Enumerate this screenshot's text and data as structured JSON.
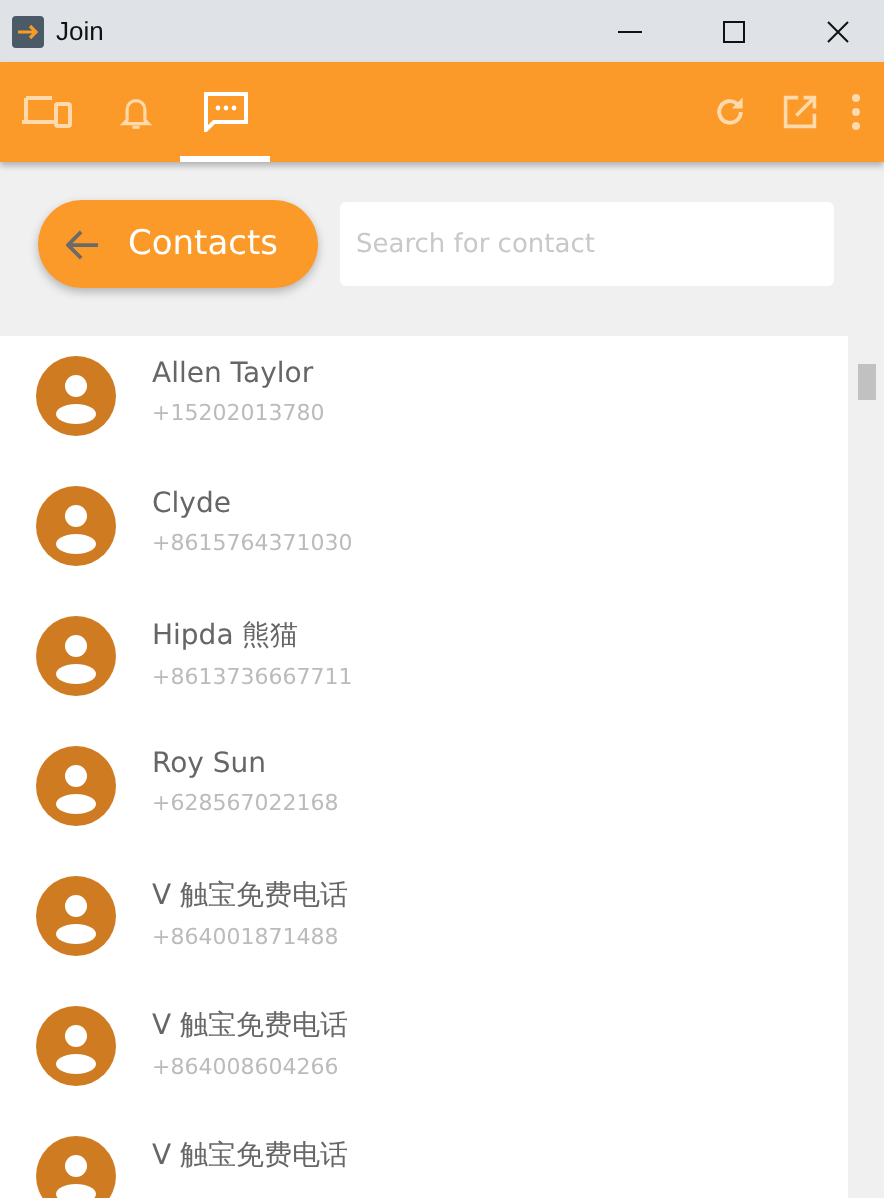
{
  "window": {
    "title": "Join"
  },
  "tabs": [
    {
      "kind": "devices",
      "selected": false
    },
    {
      "kind": "notifications",
      "selected": false
    },
    {
      "kind": "sms",
      "selected": true
    }
  ],
  "toolbar": [
    {
      "kind": "refresh"
    },
    {
      "kind": "popout"
    },
    {
      "kind": "more"
    }
  ],
  "back_button": {
    "label": "Contacts"
  },
  "search": {
    "placeholder": "Search for contact"
  },
  "contacts": [
    {
      "name": "Allen Taylor",
      "phone": "+15202013780"
    },
    {
      "name": "Clyde",
      "phone": "+8615764371030"
    },
    {
      "name": "Hipda 熊猫",
      "phone": "+8613736667711"
    },
    {
      "name": "Roy Sun",
      "phone": "+628567022168"
    },
    {
      "name": "V 触宝免费电话",
      "phone": "+864001871488"
    },
    {
      "name": "V 触宝免费电话",
      "phone": "+864008604266"
    },
    {
      "name": "V 触宝免费电话"
    }
  ]
}
